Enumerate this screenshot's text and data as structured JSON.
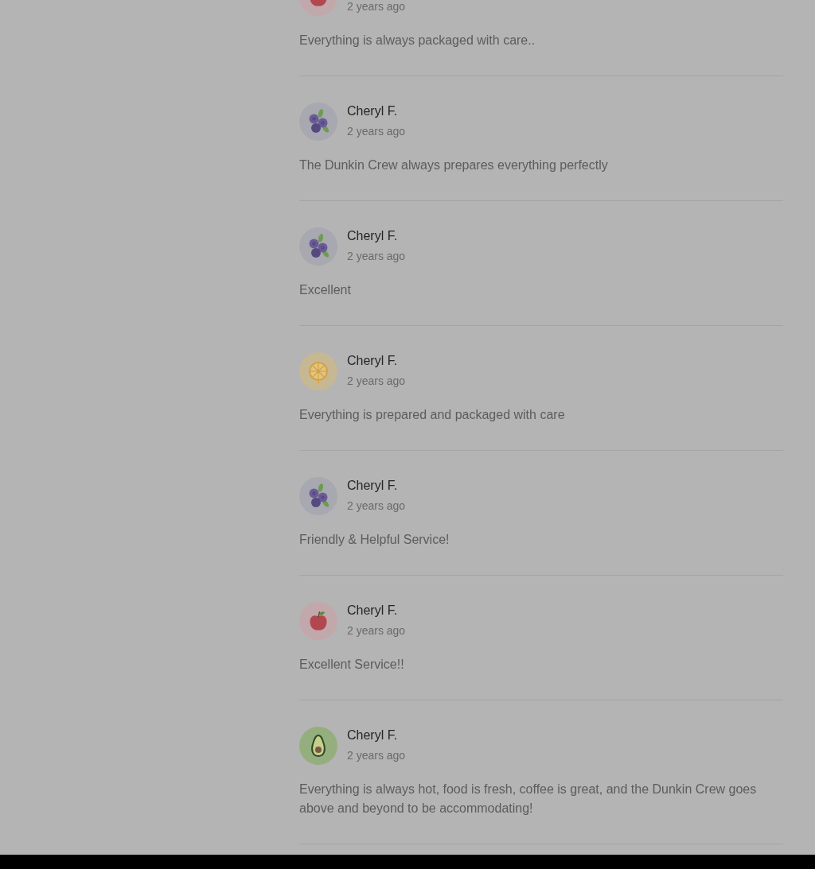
{
  "reviews": [
    {
      "kind": "apple",
      "time": "2 years ago",
      "text": "Everything is always packaged with care.."
    },
    {
      "kind": "blueberry",
      "name": "Cheryl F.",
      "time": "2 years ago",
      "text": "The Dunkin Crew always prepares everything perfectly"
    },
    {
      "kind": "blueberry",
      "name": "Cheryl F.",
      "time": "2 years ago",
      "text": "Excellent"
    },
    {
      "kind": "citrus",
      "name": "Cheryl F.",
      "time": "2 years ago",
      "text": "Everything is prepared and packaged with care"
    },
    {
      "kind": "blueberry",
      "name": "Cheryl F.",
      "time": "2 years ago",
      "text": "Friendly & Helpful Service!"
    },
    {
      "kind": "apple",
      "name": "Cheryl F.",
      "time": "2 years ago",
      "text": "Excellent Service!!"
    },
    {
      "kind": "avocado",
      "name": "Cheryl F.",
      "time": "2 years ago",
      "text": "Everything is always hot, food is fresh, coffee is great, and the Dunkin Crew goes above and beyond to be accommodating!"
    }
  ]
}
